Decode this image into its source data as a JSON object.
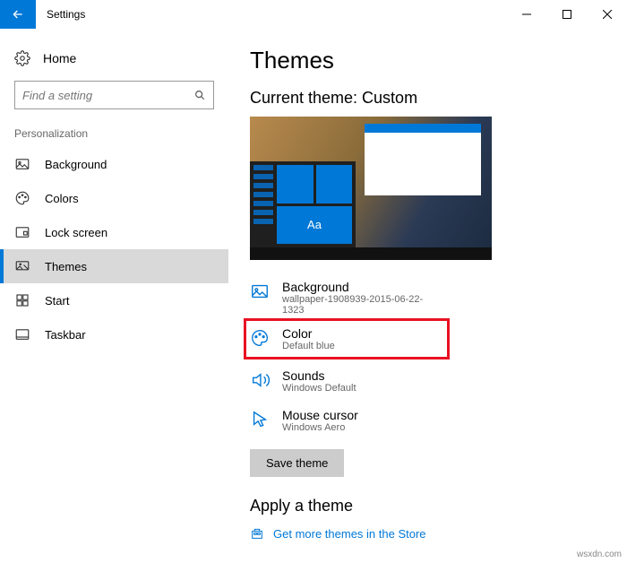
{
  "window": {
    "title": "Settings"
  },
  "sidebar": {
    "home": "Home",
    "search_placeholder": "Find a setting",
    "section": "Personalization",
    "items": [
      {
        "label": "Background"
      },
      {
        "label": "Colors"
      },
      {
        "label": "Lock screen"
      },
      {
        "label": "Themes"
      },
      {
        "label": "Start"
      },
      {
        "label": "Taskbar"
      }
    ]
  },
  "main": {
    "title": "Themes",
    "current_theme_label": "Current theme: Custom",
    "preview_tile": "Aa",
    "settings": [
      {
        "title": "Background",
        "sub": "wallpaper-1908939-2015-06-22-1323"
      },
      {
        "title": "Color",
        "sub": "Default blue"
      },
      {
        "title": "Sounds",
        "sub": "Windows Default"
      },
      {
        "title": "Mouse cursor",
        "sub": "Windows Aero"
      }
    ],
    "save_button": "Save theme",
    "apply_title": "Apply a theme",
    "store_link": "Get more themes in the Store"
  },
  "watermark": "wsxdn.com"
}
